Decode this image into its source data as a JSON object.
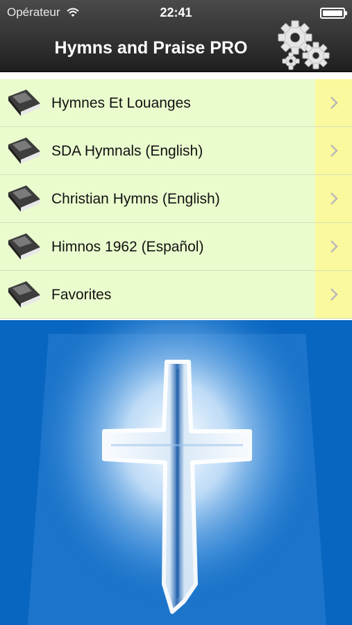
{
  "status_bar": {
    "carrier": "Opérateur",
    "time": "22:41",
    "battery_level": 1.0
  },
  "nav": {
    "title": "Hymns and Praise PRO",
    "settings_icon": "gears-icon"
  },
  "menu": {
    "items": [
      {
        "label": "Hymnes Et Louanges",
        "icon": "hymn-book-icon"
      },
      {
        "label": "SDA Hymnals (English)",
        "icon": "hymn-book-icon"
      },
      {
        "label": "Christian Hymns (English)",
        "icon": "hymn-book-icon"
      },
      {
        "label": "Himnos 1962 (Español)",
        "icon": "hymn-book-icon"
      },
      {
        "label": "Favorites",
        "icon": "hymn-book-icon"
      }
    ]
  },
  "colors": {
    "row_bg": "#eafccd",
    "accessory_bg": "#fbf99e",
    "background_blue": "#0966c0",
    "nav_bg": "#2a2a2a"
  }
}
